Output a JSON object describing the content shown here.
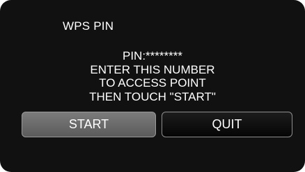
{
  "dialog": {
    "title": "WPS PIN",
    "message_lines": [
      "PIN:********",
      "ENTER THIS NUMBER",
      "TO ACCESS POINT",
      "THEN TOUCH \"START\""
    ]
  },
  "buttons": {
    "start_label": "START",
    "quit_label": "QUIT"
  },
  "colors": {
    "background": "#111111",
    "text": "#ffffff",
    "start_button": "#6b6b6b",
    "quit_button": "#0f0f0f"
  }
}
